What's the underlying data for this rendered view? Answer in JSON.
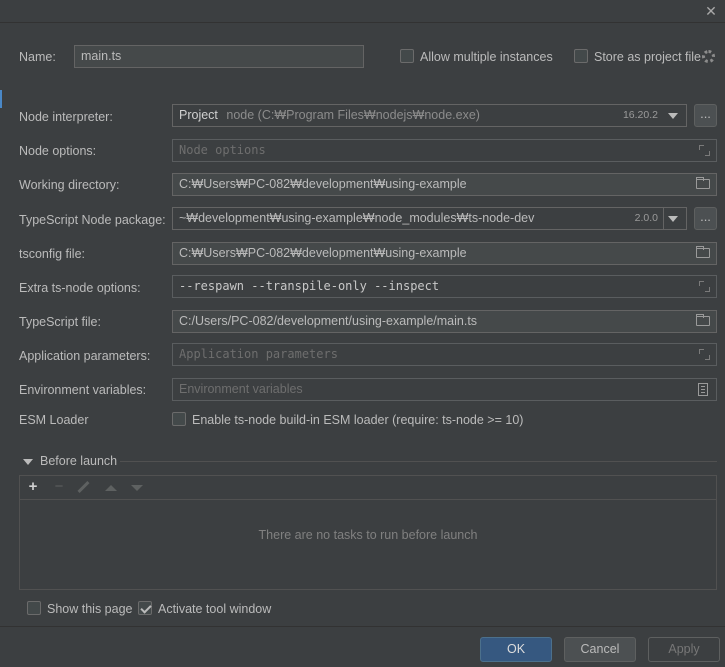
{
  "window": {
    "close_glyph": "✕"
  },
  "header": {
    "name_label": "Name:",
    "name_value": "main.ts",
    "allow_multiple_label": "Allow multiple instances",
    "allow_multiple_checked": false,
    "store_project_label": "Store as project file",
    "store_project_checked": false
  },
  "form": {
    "node_interpreter": {
      "label": "Node interpreter:",
      "prefix": "Project",
      "value": "node (C:₩Program Files₩nodejs₩node.exe)",
      "version": "16.20.2",
      "more_glyph": "..."
    },
    "node_options": {
      "label": "Node options:",
      "placeholder": "Node options"
    },
    "working_directory": {
      "label": "Working directory:",
      "value": "C:₩Users₩PC-082₩development₩using-example"
    },
    "ts_node_package": {
      "label": "TypeScript Node package:",
      "value": "~₩development₩using-example₩node_modules₩ts-node-dev",
      "version": "2.0.0",
      "more_glyph": "..."
    },
    "tsconfig": {
      "label": "tsconfig file:",
      "value": "C:₩Users₩PC-082₩development₩using-example"
    },
    "extra_options": {
      "label": "Extra ts-node options:",
      "value": "--respawn --transpile-only --inspect"
    },
    "ts_file": {
      "label": "TypeScript file:",
      "value": "C:/Users/PC-082/development/using-example/main.ts"
    },
    "app_params": {
      "label": "Application parameters:",
      "placeholder": "Application parameters"
    },
    "env_vars": {
      "label": "Environment variables:",
      "placeholder": "Environment variables"
    },
    "esm_loader": {
      "label": "ESM Loader",
      "checkbox_label": "Enable ts-node build-in ESM loader (require: ts-node >= 10)",
      "checked": false
    }
  },
  "before_launch": {
    "title": "Before launch",
    "add_glyph": "+",
    "remove_glyph": "−",
    "empty_message": "There are no tasks to run before launch"
  },
  "options": {
    "show_page_label": "Show this page",
    "show_page_checked": false,
    "activate_tool_label": "Activate tool window",
    "activate_tool_checked": true
  },
  "footer": {
    "ok": "OK",
    "cancel": "Cancel",
    "apply": "Apply"
  },
  "colors": {
    "accent": "#365880",
    "background": "#3c3f41",
    "field": "#45494a"
  }
}
